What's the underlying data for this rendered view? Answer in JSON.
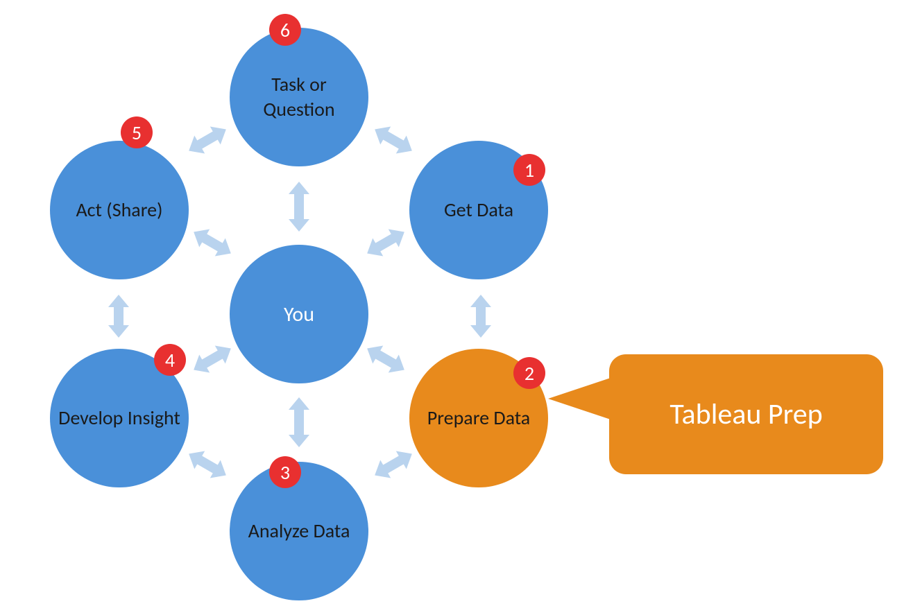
{
  "diagram": {
    "center": {
      "label": "You"
    },
    "nodes": {
      "task": {
        "label": "Task or Question",
        "number": "6"
      },
      "get_data": {
        "label": "Get Data",
        "number": "1"
      },
      "prepare": {
        "label": "Prepare Data",
        "number": "2"
      },
      "analyze": {
        "label": "Analyze Data",
        "number": "3"
      },
      "develop": {
        "label": "Develop Insight",
        "number": "4"
      },
      "act": {
        "label": "Act (Share)",
        "number": "5"
      }
    },
    "callout": {
      "label": "Tableau Prep",
      "points_to": "prepare"
    }
  },
  "colors": {
    "blue": "#4a90d9",
    "orange": "#e88a1c",
    "red": "#e83030",
    "arrow": "#b9d3ee"
  }
}
